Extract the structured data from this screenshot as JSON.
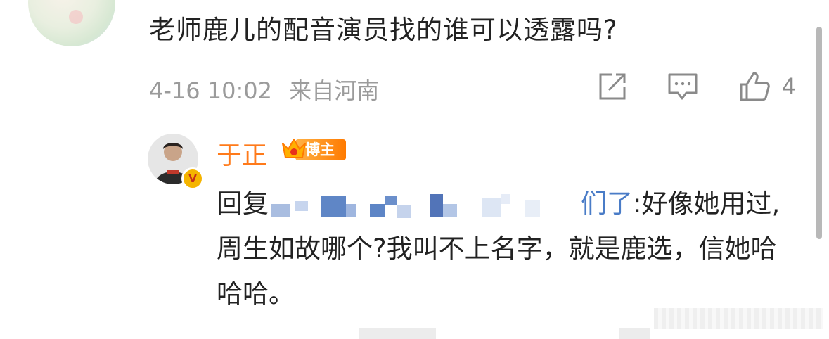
{
  "comment": {
    "text": "老师鹿儿的配音演员找的谁可以透露吗?",
    "time": "4-16 10:02",
    "location": "来自河南",
    "like_count": "4",
    "icons": [
      "share-icon",
      "comment-icon",
      "like-icon"
    ]
  },
  "reply": {
    "author": "于正",
    "badge": "博主",
    "prefix": "回复",
    "mention_tail": "们了",
    "body": ":好像她用过,周生如故哪个?我叫不上名字，就是鹿选，信她哈哈哈。"
  },
  "colors": {
    "text": "#222222",
    "meta": "#9b9b9b",
    "author": "#ff7a1a",
    "badge": "#ff8a00",
    "mention": "#4a7cc7"
  }
}
